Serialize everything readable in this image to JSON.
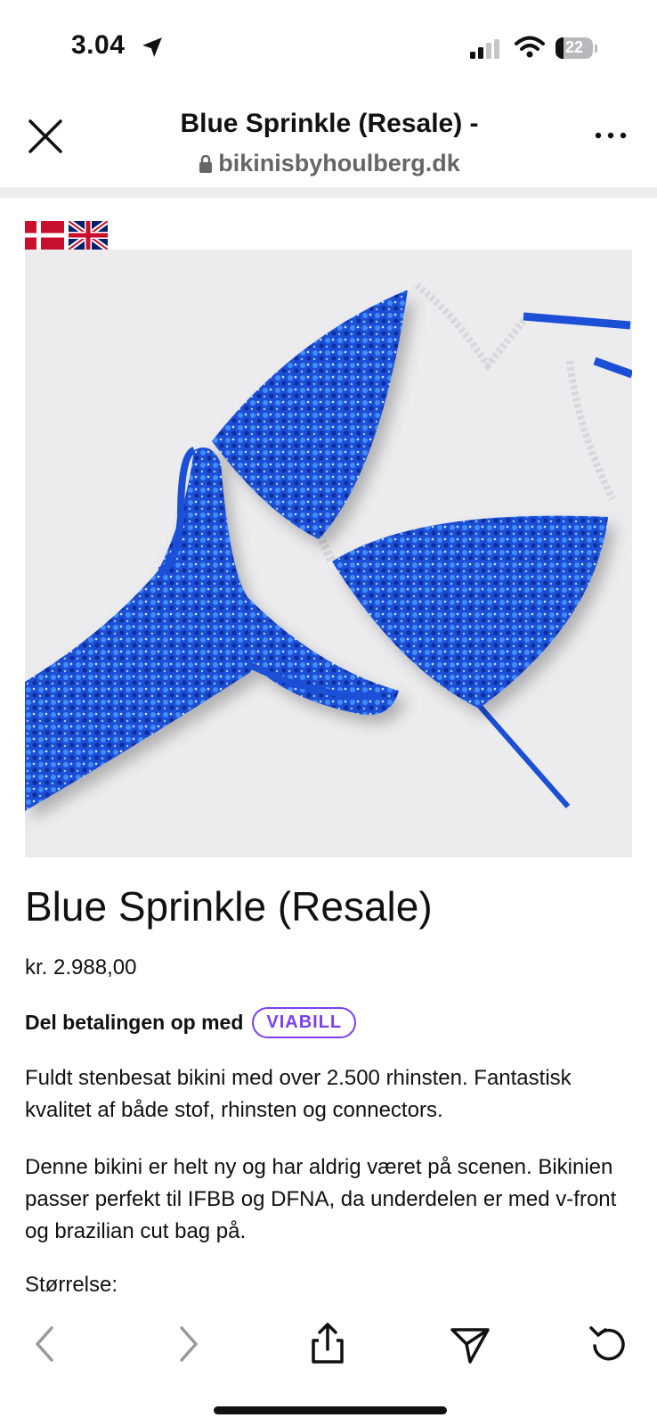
{
  "status_bar": {
    "time": "3.04",
    "battery": "22",
    "battery_level": 0.22
  },
  "browser": {
    "page_title": "Blue Sprinkle (Resale) -",
    "domain": "bikinisbyhoulberg.dk",
    "icons": [
      "close-icon",
      "more-icon",
      "lock-icon"
    ]
  },
  "languages": [
    "danish-flag",
    "uk-flag"
  ],
  "product": {
    "title": "Blue Sprinkle (Resale)",
    "price": "kr. 2.988,00",
    "installment_text": "Del betalingen op med",
    "installment_brand": "VIABILL",
    "description_1": "Fuldt stenbesat bikini med over 2.500 rhinsten. Fantastisk kvalitet af både stof, rhinsten og connectors.",
    "description_2": "Denne bikini er helt ny og har aldrig været på scenen. Bikinien passer perfekt til IFBB og DFNA, da underdelen er med v-front og brazilian cut bag på.",
    "size_label": "Størrelse:"
  },
  "colors": {
    "accent_viabill": "#7b3ff2",
    "bikini_blue": "#1a4fd6"
  },
  "toolbar": {
    "icons": [
      "back-icon",
      "forward-icon",
      "share-icon",
      "send-icon",
      "reload-icon"
    ]
  }
}
